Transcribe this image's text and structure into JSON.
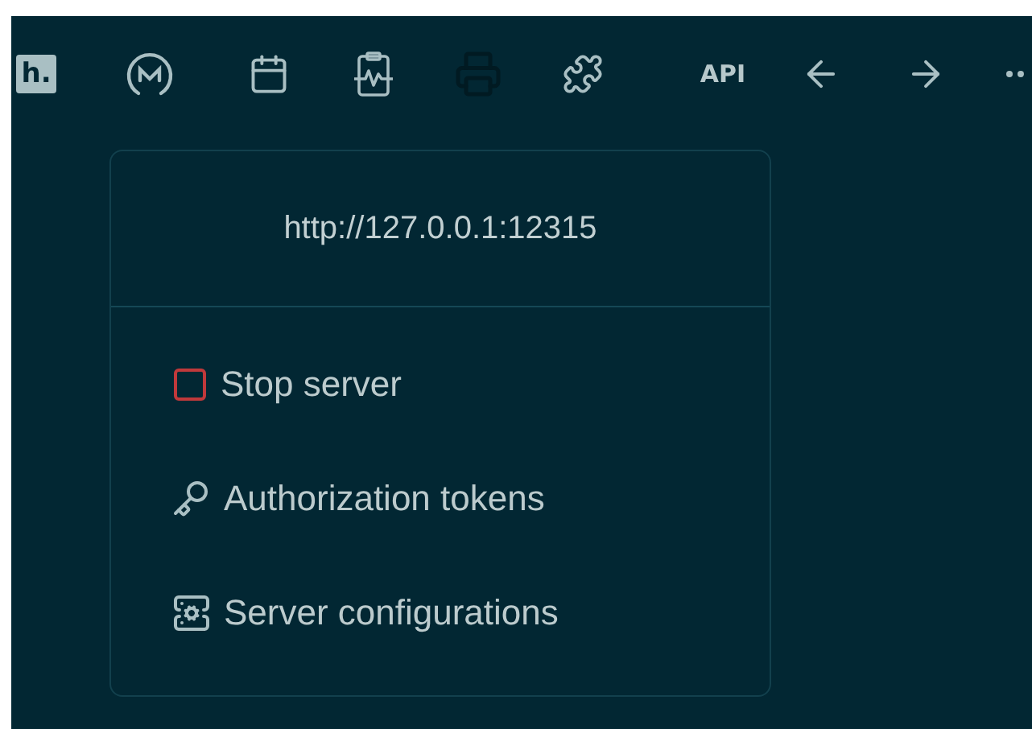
{
  "toolbar": [
    {
      "kind": "logo-h",
      "label": "h."
    },
    {
      "kind": "logo-m"
    },
    {
      "kind": "calendar"
    },
    {
      "kind": "clipboard"
    },
    {
      "kind": "printer"
    },
    {
      "kind": "puzzle"
    },
    {
      "kind": "text",
      "label": "API"
    },
    {
      "kind": "back"
    },
    {
      "kind": "forward"
    },
    {
      "kind": "more"
    }
  ],
  "menu": {
    "header": "http://127.0.0.1:12315",
    "items": [
      {
        "kind": "stop",
        "label": "Stop server"
      },
      {
        "kind": "key",
        "label": "Authorization tokens"
      },
      {
        "kind": "server-config",
        "label": "Server configurations"
      }
    ]
  }
}
